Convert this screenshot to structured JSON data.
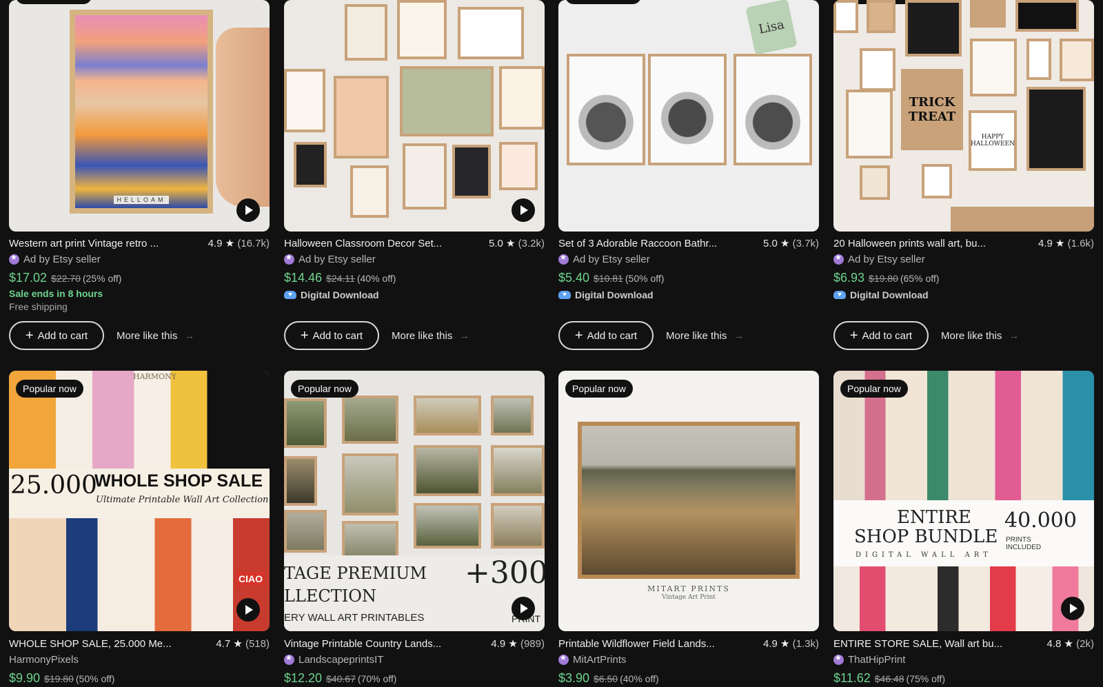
{
  "listings": [
    {
      "title": "Western art print Vintage retro ...",
      "rating": "4.9",
      "count": "(16.7k)",
      "seller": "Ad by Etsy seller",
      "price": "$17.02",
      "orig": "$22.70",
      "discount": "(25% off)",
      "sale_ends": "Sale ends in 8 hours",
      "shipping": "Free shipping",
      "cart": "Add to cart",
      "more": "More like this",
      "thumb_caption": "HELLOAM"
    },
    {
      "title": "Halloween Classroom Decor Set...",
      "rating": "5.0",
      "count": "(3.2k)",
      "seller": "Ad by Etsy seller",
      "price": "$14.46",
      "orig": "$24.11",
      "discount": "(40% off)",
      "download": "Digital Download",
      "cart": "Add to cart",
      "more": "More like this"
    },
    {
      "title": "Set of 3 Adorable Raccoon Bathr...",
      "rating": "5.0",
      "count": "(3.7k)",
      "seller": "Ad by Etsy seller",
      "price": "$5.40",
      "orig": "$10.81",
      "discount": "(50% off)",
      "download": "Digital Download",
      "cart": "Add to cart",
      "more": "More like this",
      "tag_text": "Lisa"
    },
    {
      "title": "20 Halloween prints wall art, bu...",
      "rating": "4.9",
      "count": "(1.6k)",
      "seller": "Ad by Etsy seller",
      "price": "$6.93",
      "orig": "$19.80",
      "discount": "(65% off)",
      "download": "Digital Download",
      "cart": "Add to cart",
      "more": "More like this",
      "art_text": [
        "TRICK",
        "TREAT",
        "HAPPY HALLOWEEN"
      ]
    },
    {
      "badge": "Popular now",
      "title": "WHOLE SHOP SALE, 25.000 Me...",
      "rating": "4.7",
      "count": "(518)",
      "seller": "HarmonyPixels",
      "price": "$9.90",
      "orig": "$19.80",
      "discount": "(50% off)",
      "art_big": "25.000",
      "art_head": "WHOLE SHOP SALE",
      "art_sub": "Ultimate Printable Wall Art Collection",
      "art_brand": "HARMONY",
      "art_sign": "CIAO"
    },
    {
      "badge": "Popular now",
      "title": "Vintage Printable Country Lands...",
      "rating": "4.9",
      "count": "(989)",
      "seller": "LandscapeprintsIT",
      "price": "$12.20",
      "orig": "$40.67",
      "discount": "(70% off)",
      "art_line1": "TAGE PREMIUM",
      "art_line2": "LLECTION",
      "art_line3": "ERY WALL ART PRINTABLES",
      "art_plus": "+300",
      "art_print": "PRINT"
    },
    {
      "badge": "Popular now",
      "title": "Printable Wildflower Field Lands...",
      "rating": "4.9",
      "count": "(1.3k)",
      "seller": "MitArtPrints",
      "price": "$3.90",
      "orig": "$6.50",
      "discount": "(40% off)",
      "art_brand": "MITART PRINTS",
      "art_brand_sub": "Vintage Art Print"
    },
    {
      "badge": "Popular now",
      "title": "ENTIRE STORE SALE, Wall art bu...",
      "rating": "4.8",
      "count": "(2k)",
      "seller": "ThatHipPrint",
      "price": "$11.62",
      "orig": "$46.48",
      "discount": "(75% off)",
      "art_l1": "ENTIRE",
      "art_l2": "SHOP BUNDLE",
      "art_l3": "DIGITAL WALL ART",
      "art_num": "40.000",
      "art_prints": "PRINTS",
      "art_incl": "INCLUDED"
    }
  ],
  "colors": {
    "sale_green": "#6fd58f",
    "background": "#111111",
    "seller_badge": "#a07ad6",
    "download_icon": "#5ea2f2"
  }
}
